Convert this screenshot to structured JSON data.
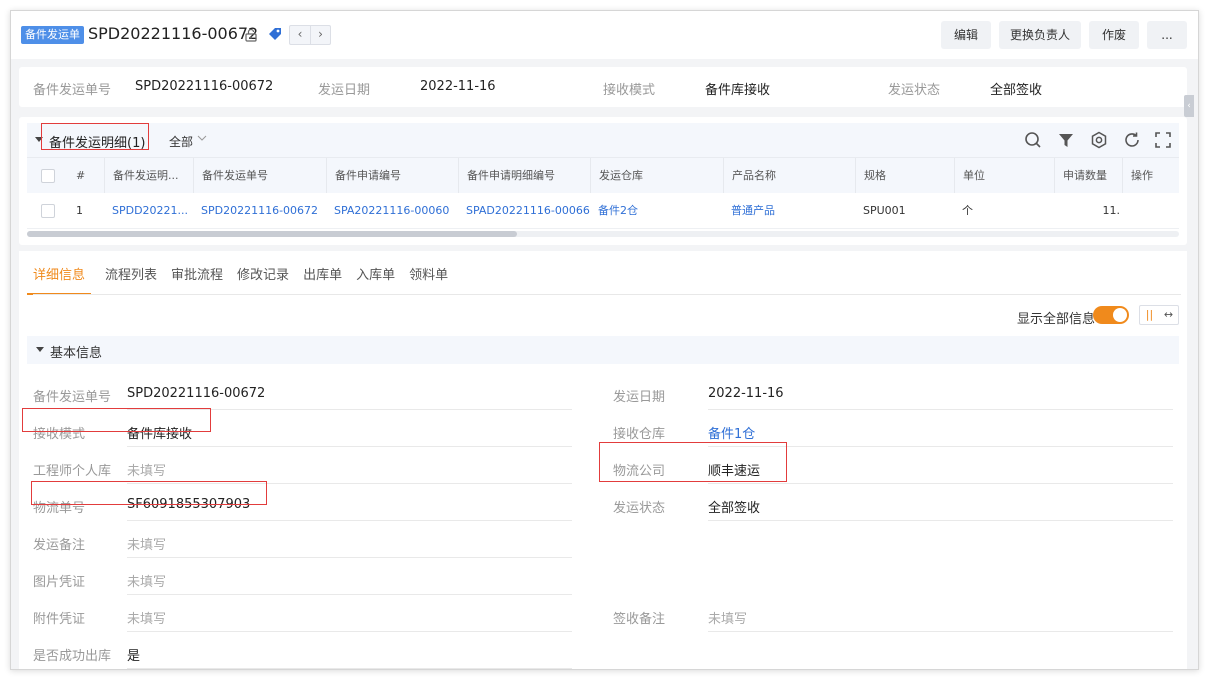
{
  "header": {
    "type_badge": "备件发运单",
    "doc_number": "SPD20221116-00672",
    "nav_prev": "‹",
    "nav_next": "›",
    "buttons": {
      "edit": "编辑",
      "change_owner": "更换负责人",
      "void": "作废",
      "more": "..."
    }
  },
  "summary": {
    "items": [
      {
        "label": "备件发运单号",
        "value": "SPD20221116-00672"
      },
      {
        "label": "发运日期",
        "value": "2022-11-16"
      },
      {
        "label": "接收模式",
        "value": "备件库接收"
      },
      {
        "label": "发运状态",
        "value": "全部签收"
      }
    ]
  },
  "detail_table": {
    "title": "备件发运明细(1)",
    "filter": "全部",
    "toolbar_icons": [
      "search-icon",
      "filter-icon",
      "settings-icon",
      "refresh-icon",
      "fullscreen-icon"
    ],
    "columns": [
      "#",
      "备件发运明...",
      "备件发运单号",
      "备件申请编号",
      "备件申请明细编号",
      "发运仓库",
      "产品名称",
      "规格",
      "单位",
      "申请数量",
      "操作"
    ],
    "rows": [
      {
        "index": "1",
        "detail_no": "SPDD20221...",
        "shipment_no": "SPD20221116-00672",
        "apply_no": "SPA20221116-00060",
        "apply_detail_no": "SPAD20221116-00066",
        "warehouse": "备件2仓",
        "product": "普通产品",
        "spec": "SPU001",
        "unit": "个",
        "qty": "11.",
        "ops": ""
      }
    ]
  },
  "tabs": [
    "详细信息",
    "流程列表",
    "审批流程",
    "修改记录",
    "出库单",
    "入库单",
    "领料单"
  ],
  "show_all": {
    "label": "显示全部信息",
    "on": true
  },
  "layout_toggle": {
    "columns": "||",
    "expand": "↔"
  },
  "basic_info": {
    "title": "基本信息",
    "left": [
      {
        "label": "备件发运单号",
        "value": "SPD20221116-00672"
      },
      {
        "label": "接收模式",
        "value": "备件库接收"
      },
      {
        "label": "工程师个人库",
        "value": "未填写"
      },
      {
        "label": "物流单号",
        "value": "SF6091855307903"
      },
      {
        "label": "发运备注",
        "value": "未填写"
      },
      {
        "label": "图片凭证",
        "value": "未填写"
      },
      {
        "label": "附件凭证",
        "value": "未填写"
      },
      {
        "label": "是否成功出库",
        "value": "是"
      }
    ],
    "right": [
      {
        "label": "发运日期",
        "value": "2022-11-16"
      },
      {
        "label": "接收仓库",
        "value": "备件1仓"
      },
      {
        "label": "物流公司",
        "value": "顺丰速运"
      },
      {
        "label": "发运状态",
        "value": "全部签收"
      },
      {
        "label": "签收备注",
        "value": "未填写"
      }
    ]
  },
  "colors": {
    "accent_orange": "#f08a1c",
    "link_blue": "#2f6fd6",
    "highlight_red": "#e23c3c",
    "badge_blue": "#4e8fe8"
  }
}
